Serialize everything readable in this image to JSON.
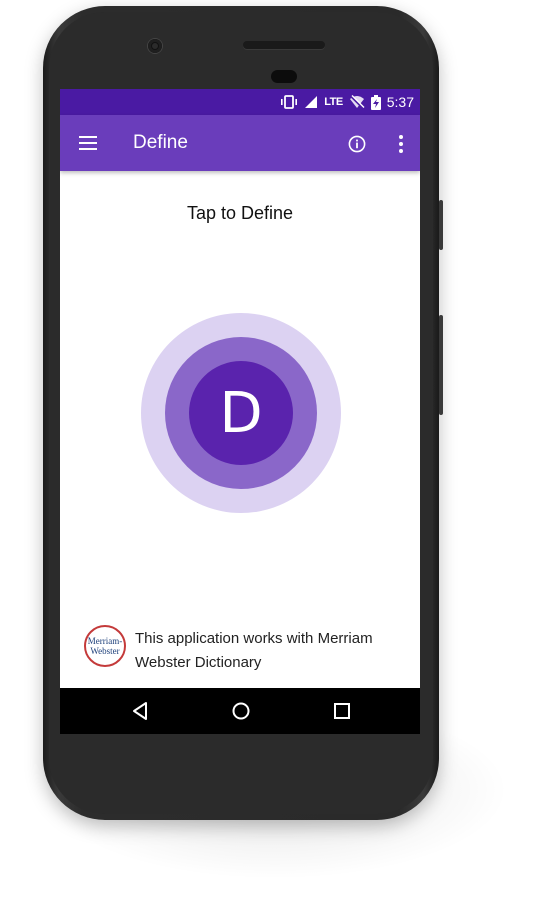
{
  "status_bar": {
    "network": "LTE",
    "time": "5:37"
  },
  "app_bar": {
    "title": "Define",
    "icons": [
      "menu-icon",
      "info-icon",
      "more-vert-icon"
    ]
  },
  "main": {
    "heading": "Tap to Define",
    "button_letter": "D"
  },
  "footer": {
    "logo_line1": "Merriam-",
    "logo_line2": "Webster",
    "text": "This application works with Merriam Webster Dictionary"
  },
  "nav_bar": {
    "icons": [
      "back-icon",
      "home-icon",
      "recents-icon"
    ]
  },
  "colors": {
    "status_bar": "#4a1aa3",
    "app_bar": "#6a3dbb",
    "circle_outer": "#dcd2f2",
    "circle_middle": "#8a67c9",
    "circle_inner": "#5a23ad"
  }
}
